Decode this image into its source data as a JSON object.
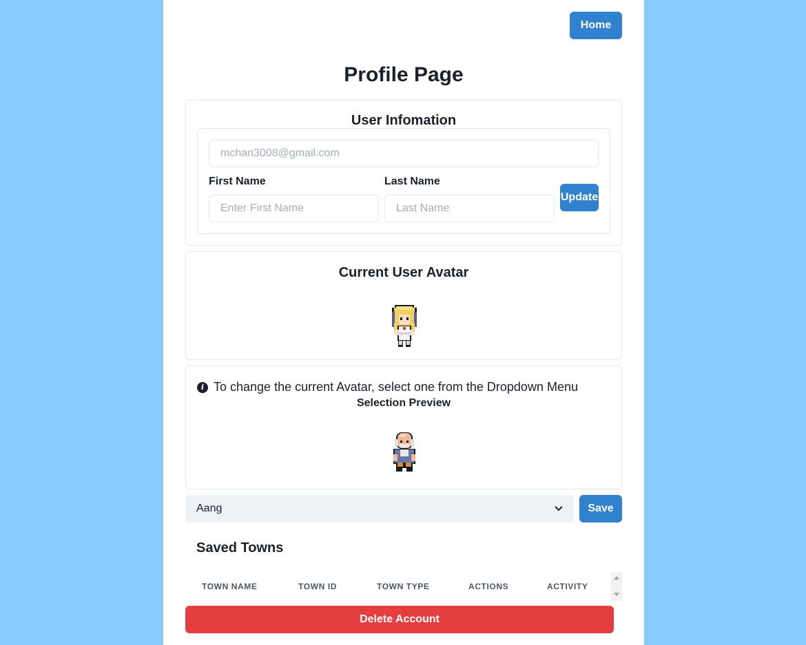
{
  "nav": {
    "home_label": "Home"
  },
  "page": {
    "title": "Profile Page"
  },
  "user_info": {
    "title": "User Infomation",
    "email_placeholder": "mchan3008@gmail.com",
    "first_name_label": "First Name",
    "first_name_placeholder": "Enter First Name",
    "last_name_label": "Last Name",
    "last_name_placeholder": "Last Name",
    "update_label": "Update"
  },
  "avatar": {
    "title": "Current User Avatar",
    "sprite": "blonde-character-sprite"
  },
  "selection": {
    "info_text": "To change the current Avatar, select one from the Dropdown Menu",
    "preview_label": "Selection Preview",
    "sprite": "bald-old-man-sprite",
    "selected_value": "Aang",
    "save_label": "Save"
  },
  "saved_towns": {
    "title": "Saved Towns",
    "columns": [
      "TOWN NAME",
      "TOWN ID",
      "TOWN TYPE",
      "ACTIONS",
      "ACTIVITY"
    ]
  },
  "account": {
    "delete_label": "Delete Account"
  },
  "colors": {
    "background": "#87cbfd",
    "primary": "#3182ce",
    "danger": "#e53e3e"
  }
}
